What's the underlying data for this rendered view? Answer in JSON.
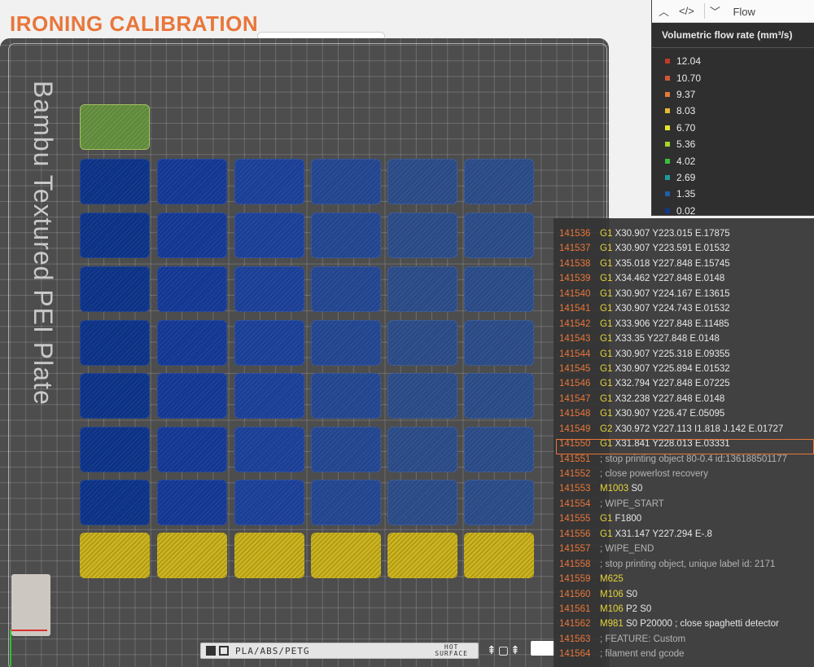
{
  "title": "IRONING CALIBRATION",
  "plate": {
    "label": "Bambu Textured PEI Plate",
    "filament": "PLA/ABS/PETG",
    "hot_surface": [
      "HOT",
      "SURFACE"
    ],
    "side_icons": "⇞▢⇞"
  },
  "tiles": {
    "rows": [
      [
        "green"
      ],
      [
        "blue",
        "blue",
        "blue",
        "blue",
        "blue",
        "blue"
      ],
      [
        "blue",
        "blue",
        "blue",
        "blue",
        "blue",
        "blue"
      ],
      [
        "blue",
        "blue",
        "blue",
        "blue",
        "blue",
        "blue"
      ],
      [
        "blue",
        "blue",
        "blue",
        "blue",
        "blue",
        "blue"
      ],
      [
        "blue",
        "blue",
        "blue",
        "blue",
        "blue",
        "blue"
      ],
      [
        "blue",
        "blue",
        "blue",
        "blue",
        "blue",
        "blue"
      ],
      [
        "blue",
        "blue",
        "blue",
        "blue",
        "blue",
        "blue"
      ],
      [
        "yellow",
        "yellow",
        "yellow",
        "yellow",
        "yellow",
        "yellow"
      ]
    ]
  },
  "legend": {
    "toolbar": {
      "collapse_icon": "︿",
      "code_icon": "</>",
      "dropdown_icon": "﹀",
      "view": "Flow"
    },
    "title": "Volumetric flow rate (mm³/s)",
    "items": [
      {
        "value": "12.04",
        "color": "#c0392b"
      },
      {
        "value": "10.70",
        "color": "#d4553a"
      },
      {
        "value": "9.37",
        "color": "#e07b39"
      },
      {
        "value": "8.03",
        "color": "#e8b830"
      },
      {
        "value": "6.70",
        "color": "#e8e32c"
      },
      {
        "value": "5.36",
        "color": "#a6d62c"
      },
      {
        "value": "4.02",
        "color": "#3bbf3b"
      },
      {
        "value": "2.69",
        "color": "#1f9a9a"
      },
      {
        "value": "1.35",
        "color": "#1f5fa8"
      },
      {
        "value": "0.02",
        "color": "#103a8c"
      }
    ]
  },
  "gcode": {
    "lines": [
      {
        "n": "141536",
        "cmd": "G1",
        "args": "X30.907 Y223.015 E.17875"
      },
      {
        "n": "141537",
        "cmd": "G1",
        "args": "X30.907 Y223.591 E.01532"
      },
      {
        "n": "141538",
        "cmd": "G1",
        "args": "X35.018 Y227.848 E.15745"
      },
      {
        "n": "141539",
        "cmd": "G1",
        "args": "X34.462 Y227.848 E.0148"
      },
      {
        "n": "141540",
        "cmd": "G1",
        "args": "X30.907 Y224.167 E.13615"
      },
      {
        "n": "141541",
        "cmd": "G1",
        "args": "X30.907 Y224.743 E.01532"
      },
      {
        "n": "141542",
        "cmd": "G1",
        "args": "X33.906 Y227.848 E.11485"
      },
      {
        "n": "141543",
        "cmd": "G1",
        "args": "X33.35 Y227.848 E.0148"
      },
      {
        "n": "141544",
        "cmd": "G1",
        "args": "X30.907 Y225.318 E.09355"
      },
      {
        "n": "141545",
        "cmd": "G1",
        "args": "X30.907 Y225.894 E.01532"
      },
      {
        "n": "141546",
        "cmd": "G1",
        "args": "X32.794 Y227.848 E.07225"
      },
      {
        "n": "141547",
        "cmd": "G1",
        "args": "X32.238 Y227.848 E.0148"
      },
      {
        "n": "141548",
        "cmd": "G1",
        "args": "X30.907 Y226.47 E.05095"
      },
      {
        "n": "141549",
        "cmd": "G2",
        "args": "X30.972 Y227.113 I1.818 J.142 E.01727"
      },
      {
        "n": "141550",
        "cmd": "G1",
        "args": "X31.841 Y228.013 E.03331",
        "current": true
      },
      {
        "n": "141551",
        "cmd": "",
        "args": "; stop printing object 80-0.4 id:136188501177"
      },
      {
        "n": "141552",
        "cmd": "",
        "args": "; close powerlost recovery"
      },
      {
        "n": "141553",
        "cmd": "M1003",
        "args": "S0"
      },
      {
        "n": "141554",
        "cmd": "",
        "args": "; WIPE_START"
      },
      {
        "n": "141555",
        "cmd": "G1",
        "args": "F1800"
      },
      {
        "n": "141556",
        "cmd": "G1",
        "args": "X31.147 Y227.294 E-.8"
      },
      {
        "n": "141557",
        "cmd": "",
        "args": "; WIPE_END"
      },
      {
        "n": "141558",
        "cmd": "",
        "args": "; stop printing object, unique label id: 2171"
      },
      {
        "n": "141559",
        "cmd": "M625",
        "args": ""
      },
      {
        "n": "141560",
        "cmd": "M106",
        "args": "S0"
      },
      {
        "n": "141561",
        "cmd": "M106",
        "args": "P2 S0"
      },
      {
        "n": "141562",
        "cmd": "M981",
        "args": "S0 P20000 ; close spaghetti detector"
      },
      {
        "n": "141563",
        "cmd": "",
        "args": "; FEATURE: Custom"
      },
      {
        "n": "141564",
        "cmd": "",
        "args": "; filament end gcode"
      }
    ]
  }
}
